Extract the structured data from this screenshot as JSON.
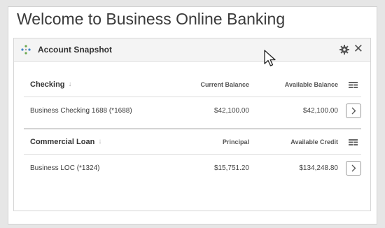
{
  "page": {
    "title": "Welcome to Business Online Banking"
  },
  "widget": {
    "title": "Account Snapshot",
    "move_icon": "move-arrows-icon",
    "settings_icon": "gear-icon",
    "close_label": "✕"
  },
  "sections": [
    {
      "name": "Checking",
      "col2": "Current Balance",
      "col3": "Available Balance",
      "account": "Business Checking 1688 (*1688)",
      "value2": "$42,100.00",
      "value3": "$42,100.00"
    },
    {
      "name": "Commercial Loan",
      "col2": "Principal",
      "col3": "Available Credit",
      "account": "Business LOC (*1324)",
      "value2": "$15,751.20",
      "value3": "$134,248.80"
    }
  ],
  "colors": {
    "background": "#e6e6e6",
    "panel": "#ffffff",
    "header": "#f4f4f4",
    "border": "#d6d6d6"
  }
}
